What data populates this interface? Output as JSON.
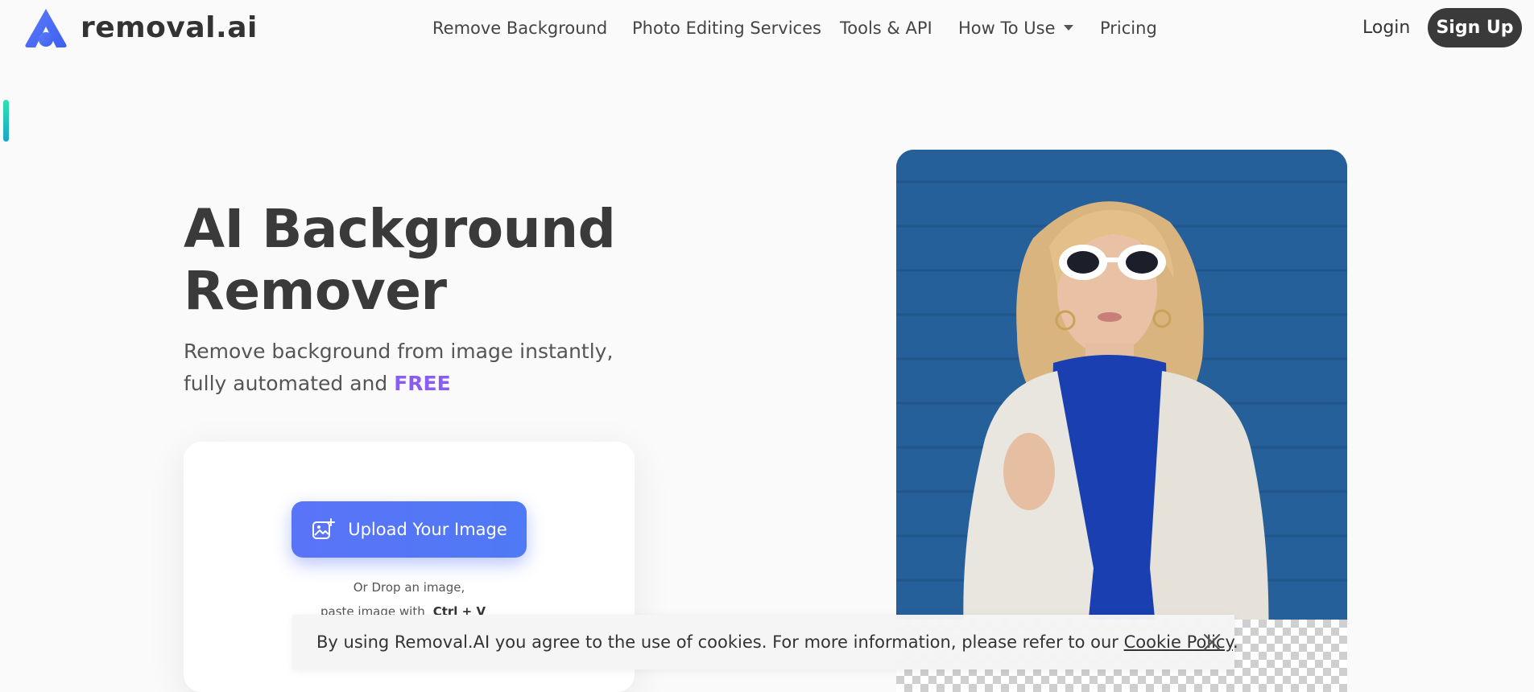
{
  "brand": {
    "name": "removal.ai",
    "accent": "#4f6bf7"
  },
  "nav": {
    "items": [
      {
        "label": "Remove Background"
      },
      {
        "label": "Photo Editing Services"
      },
      {
        "label": "Tools & API"
      },
      {
        "label": "How To Use"
      },
      {
        "label": "Pricing"
      }
    ],
    "login": "Login",
    "signup": "Sign Up"
  },
  "hero": {
    "title_line1": "AI Background",
    "title_line2": "Remover",
    "subtitle_line1": "Remove background from image instantly,",
    "subtitle_line2": "fully automated and ",
    "subtitle_highlight": "FREE",
    "highlight_color": "#8a5cf6"
  },
  "upload": {
    "button_label": "Upload Your Image",
    "drop_text": "Or Drop an image,",
    "paste_text": "paste image with",
    "paste_shortcut": "Ctrl + V"
  },
  "cookie": {
    "text": "By using Removal.AI you agree to the use of cookies. For more information, please refer to our ",
    "link": "Cookie Policy",
    "suffix": "."
  }
}
